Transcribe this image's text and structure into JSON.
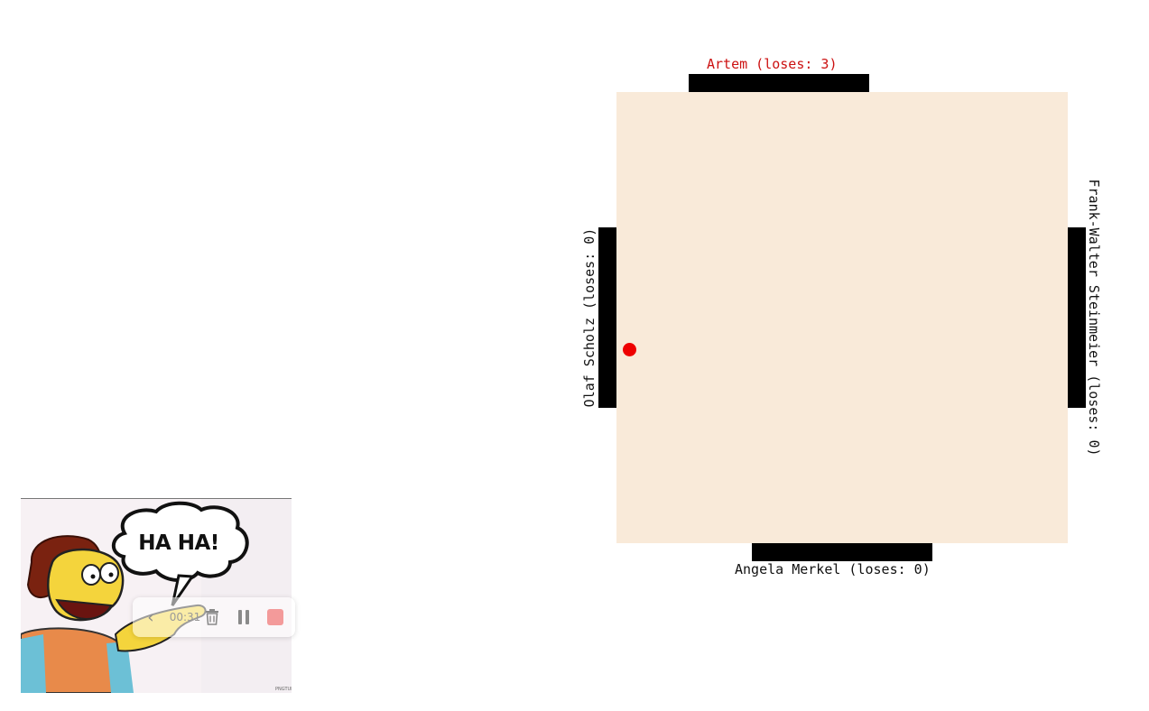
{
  "game": {
    "players": {
      "top": {
        "label": "Artem (loses: 3)",
        "color": "#cc1111"
      },
      "bottom": {
        "label": "Angela Merkel (loses: 0)",
        "color": "#111111"
      },
      "left": {
        "label": "Olaf Scholz (loses: 0)",
        "color": "#111111"
      },
      "right": {
        "label": "Frank-Walter Steinmeier (loses: 0)",
        "color": "#111111"
      }
    },
    "colors": {
      "board": "#f9ead9",
      "paddle": "#000000",
      "ball": "#ee0000"
    }
  },
  "meme": {
    "speech_bubble": "HA HA!",
    "recorder": {
      "back_icon": "chevron-left-icon",
      "time": "00:31",
      "trash_icon": "trash-icon",
      "pause_icon": "pause-icon",
      "stop_icon": "stop-icon"
    }
  }
}
